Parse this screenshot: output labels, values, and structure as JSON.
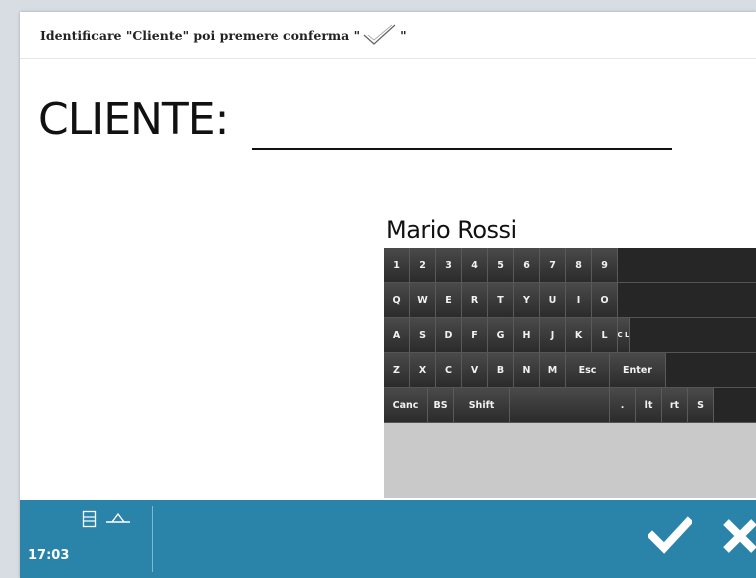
{
  "instruction": {
    "prefix": "Identificare \"Cliente\" poi premere conferma \"",
    "suffix": "\""
  },
  "field": {
    "label": "CLIENTE:"
  },
  "input": {
    "value": "Mario Rossi"
  },
  "keyboard": {
    "rows": [
      [
        "1",
        "2",
        "3",
        "4",
        "5",
        "6",
        "7",
        "8",
        "9"
      ],
      [
        "Q",
        "W",
        "E",
        "R",
        "T",
        "Y",
        "U",
        "I",
        "O"
      ],
      [
        "A",
        "S",
        "D",
        "F",
        "G",
        "H",
        "J",
        "K",
        "L",
        "C L"
      ],
      [
        "Z",
        "X",
        "C",
        "V",
        "B",
        "N",
        "M",
        "Esc",
        "Enter"
      ],
      [
        "Canc",
        "BS",
        "Shift",
        "",
        ".",
        " lt",
        "rt",
        "S"
      ]
    ]
  },
  "taskbar": {
    "time": "17:03",
    "icons": [
      "document-icon",
      "signal-icon"
    ],
    "confirm_icon": "check-icon",
    "cancel_icon": "close-icon",
    "background": "#2a84a9"
  }
}
